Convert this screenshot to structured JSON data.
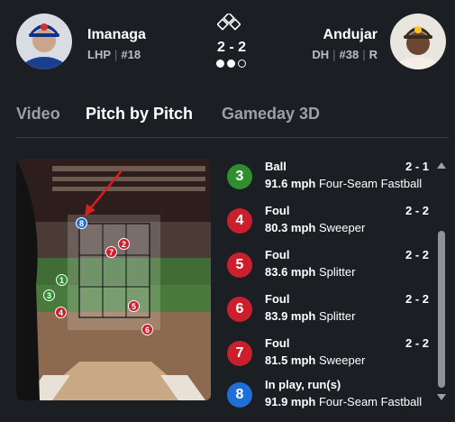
{
  "pitcher": {
    "name": "Imanaga",
    "hand": "LHP",
    "number": "#18"
  },
  "batter": {
    "name": "Andujar",
    "pos": "DH",
    "number": "#38",
    "hand": "R"
  },
  "count": {
    "display": "2 - 2",
    "outs_filled": 2,
    "outs_total": 3
  },
  "tabs": [
    {
      "label": "Video",
      "active": false
    },
    {
      "label": "Pitch by Pitch",
      "active": true
    },
    {
      "label": "Gameday 3D",
      "active": false
    }
  ],
  "strike_zone_markers": [
    {
      "label": "1",
      "color": "green"
    },
    {
      "label": "2",
      "color": "red"
    },
    {
      "label": "3",
      "color": "green"
    },
    {
      "label": "4",
      "color": "red"
    },
    {
      "label": "5",
      "color": "red"
    },
    {
      "label": "6",
      "color": "red"
    },
    {
      "label": "7",
      "color": "red"
    },
    {
      "label": "8",
      "color": "blue"
    }
  ],
  "pitches": [
    {
      "num": "3",
      "result": "Ball",
      "count": "2 - 1",
      "speed": "91.6 mph",
      "type": "Four-Seam Fastball",
      "color": "green"
    },
    {
      "num": "4",
      "result": "Foul",
      "count": "2 - 2",
      "speed": "80.3 mph",
      "type": "Sweeper",
      "color": "red"
    },
    {
      "num": "5",
      "result": "Foul",
      "count": "2 - 2",
      "speed": "83.6 mph",
      "type": "Splitter",
      "color": "red"
    },
    {
      "num": "6",
      "result": "Foul",
      "count": "2 - 2",
      "speed": "83.9 mph",
      "type": "Splitter",
      "color": "red"
    },
    {
      "num": "7",
      "result": "Foul",
      "count": "2 - 2",
      "speed": "81.5 mph",
      "type": "Sweeper",
      "color": "red"
    },
    {
      "num": "8",
      "result": "In play, run(s)",
      "count": "",
      "speed": "91.9 mph",
      "type": "Four-Seam Fastball",
      "color": "blue"
    }
  ],
  "colors": {
    "ball": "#2f8f2f",
    "strike": "#cc1f2d",
    "in_play": "#1f6fd6",
    "background": "#1b1f24"
  }
}
